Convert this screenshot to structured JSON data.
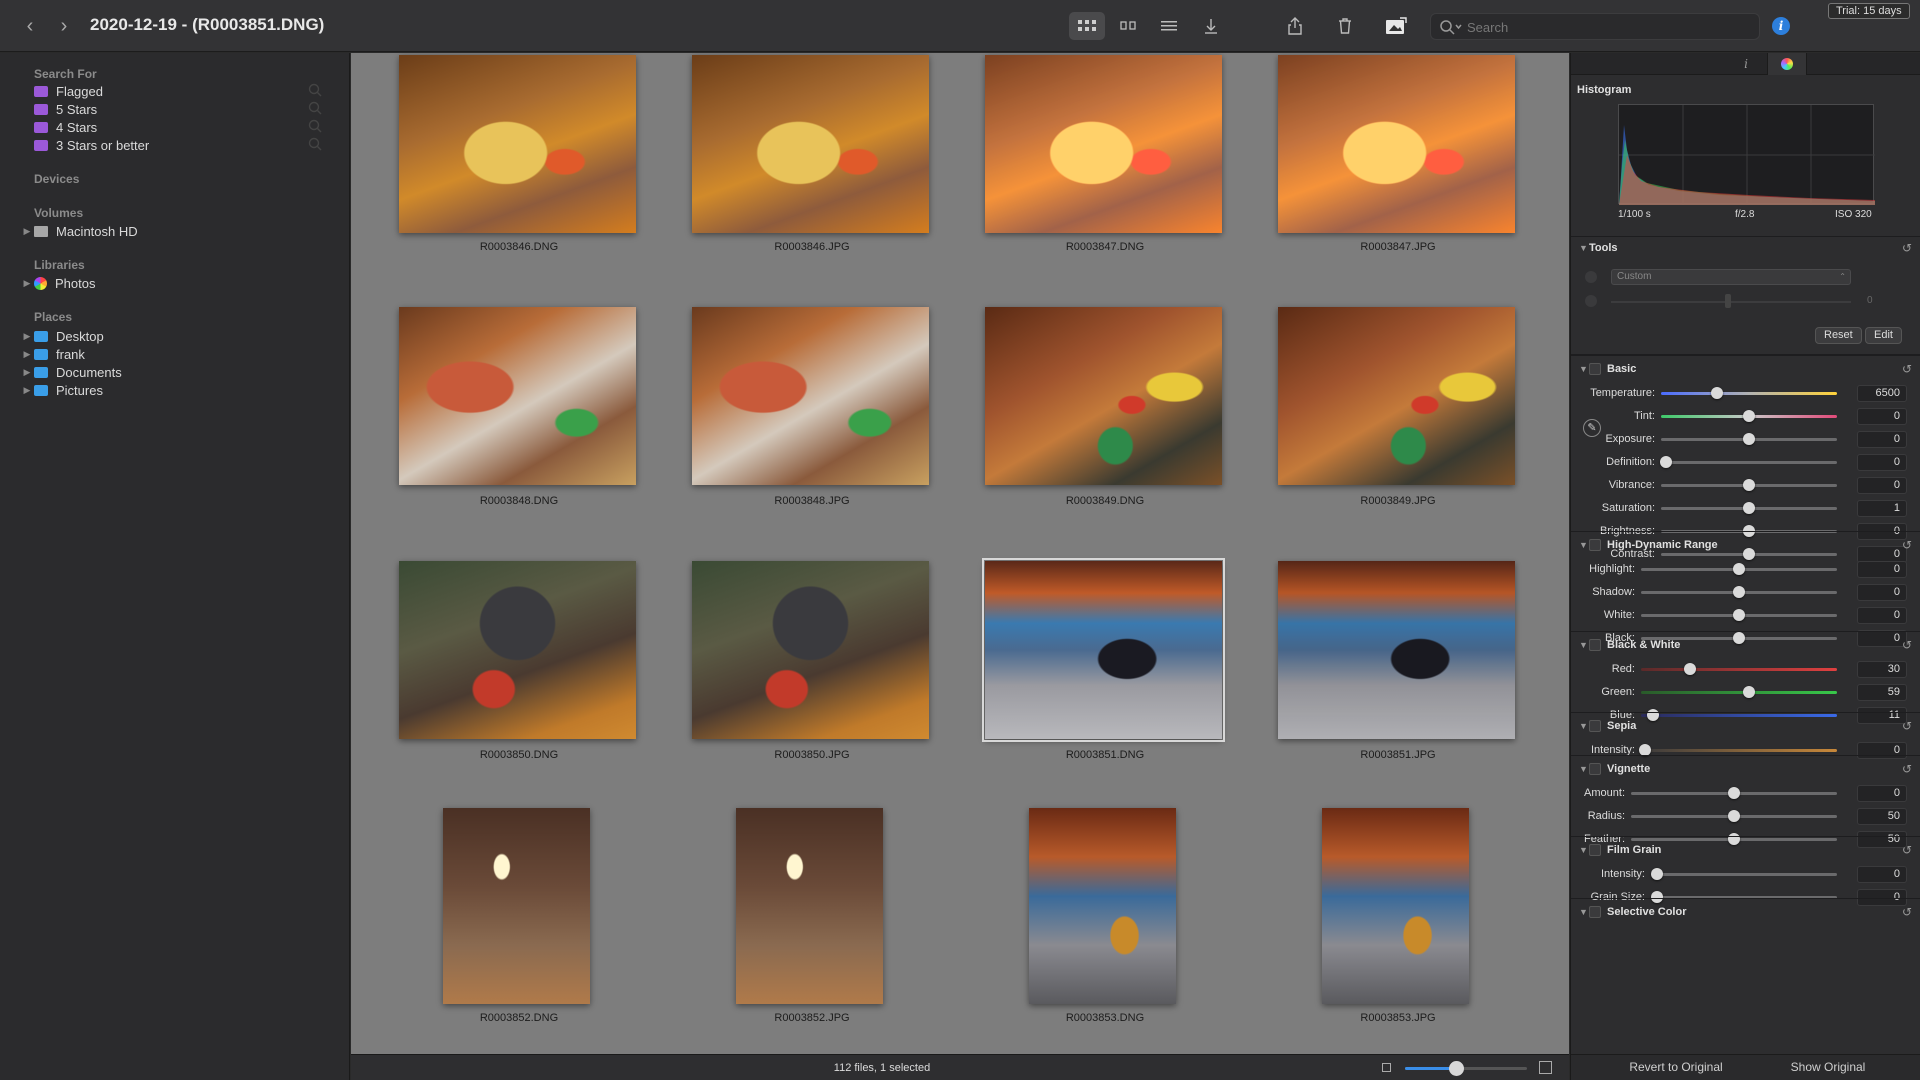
{
  "window": {
    "title": "2020-12-19 - (R0003851.DNG)",
    "trial_badge": "Trial: 15 days",
    "search_placeholder": "Search"
  },
  "sidebar": {
    "search_for": {
      "heading": "Search For",
      "items": [
        "Flagged",
        "5 Stars",
        "4 Stars",
        "3 Stars or better"
      ]
    },
    "devices": {
      "heading": "Devices"
    },
    "volumes": {
      "heading": "Volumes",
      "items": [
        "Macintosh HD"
      ]
    },
    "libraries": {
      "heading": "Libraries",
      "items": [
        "Photos"
      ]
    },
    "places": {
      "heading": "Places",
      "items": [
        "Desktop",
        "frank",
        "Documents",
        "Pictures"
      ]
    }
  },
  "grid": {
    "files": [
      "R0003846.DNG",
      "R0003846.JPG",
      "R0003847.DNG",
      "R0003847.JPG",
      "R0003848.DNG",
      "R0003848.JPG",
      "R0003849.DNG",
      "R0003849.JPG",
      "R0003850.DNG",
      "R0003850.JPG",
      "R0003851.DNG",
      "R0003851.JPG",
      "R0003852.DNG",
      "R0003852.JPG",
      "R0003853.DNG",
      "R0003853.JPG"
    ],
    "selected": "R0003851.DNG"
  },
  "status": {
    "text": "112 files, 1 selected",
    "zoom_level": 0.42
  },
  "inspector": {
    "histogram": {
      "title": "Histogram",
      "shutter": "1/100 s",
      "aperture": "f/2.8",
      "iso": "ISO 320"
    },
    "tools": {
      "title": "Tools",
      "preset": "Custom",
      "amount_value": "0",
      "reset_label": "Reset",
      "edit_label": "Edit"
    },
    "basic": {
      "title": "Basic",
      "controls": [
        {
          "label": "Temperature:",
          "value": "6500",
          "level": 0.32
        },
        {
          "label": "Tint:",
          "value": "0",
          "level": 0.5
        },
        {
          "label": "Exposure:",
          "value": "0",
          "level": 0.5
        },
        {
          "label": "Definition:",
          "value": "0",
          "level": 0.03
        },
        {
          "label": "Vibrance:",
          "value": "0",
          "level": 0.5
        },
        {
          "label": "Saturation:",
          "value": "1",
          "level": 0.5
        },
        {
          "label": "Brightness:",
          "value": "0",
          "level": 0.5
        },
        {
          "label": "Contrast:",
          "value": "0",
          "level": 0.5
        }
      ]
    },
    "hdr": {
      "title": "High-Dynamic Range",
      "controls": [
        {
          "label": "Highlight:",
          "value": "0",
          "level": 0.5
        },
        {
          "label": "Shadow:",
          "value": "0",
          "level": 0.5
        },
        {
          "label": "White:",
          "value": "0",
          "level": 0.5
        },
        {
          "label": "Black:",
          "value": "0",
          "level": 0.5
        }
      ]
    },
    "bw": {
      "title": "Black & White",
      "controls": [
        {
          "label": "Red:",
          "value": "30",
          "level": 0.25
        },
        {
          "label": "Green:",
          "value": "59",
          "level": 0.55
        },
        {
          "label": "Blue:",
          "value": "11",
          "level": 0.06
        }
      ]
    },
    "sepia": {
      "title": "Sepia",
      "controls": [
        {
          "label": "Intensity:",
          "value": "0",
          "level": 0.02
        }
      ]
    },
    "vignette": {
      "title": "Vignette",
      "controls": [
        {
          "label": "Amount:",
          "value": "0",
          "level": 0.5
        },
        {
          "label": "Radius:",
          "value": "50",
          "level": 0.5
        },
        {
          "label": "Feather:",
          "value": "50",
          "level": 0.5
        }
      ]
    },
    "film_grain": {
      "title": "Film Grain",
      "controls": [
        {
          "label": "Intensity:",
          "value": "0",
          "level": 0.03
        },
        {
          "label": "Grain Size:",
          "value": "0",
          "level": 0.03
        }
      ]
    },
    "selective_color": {
      "title": "Selective Color"
    },
    "revert_label": "Revert to Original",
    "show_original_label": "Show Original"
  },
  "colors": {
    "accent": "#3a8ee8",
    "smart_folder": "#9b59d9",
    "folder": "#3a9ee8",
    "info": "#2d7fdc"
  },
  "icons": [
    "back-icon",
    "forward-icon",
    "grid-view-icon",
    "filmstrip-view-icon",
    "list-view-icon",
    "upload-icon",
    "share-icon",
    "trash-icon",
    "edit-photo-icon",
    "search-icon",
    "info-icon"
  ]
}
